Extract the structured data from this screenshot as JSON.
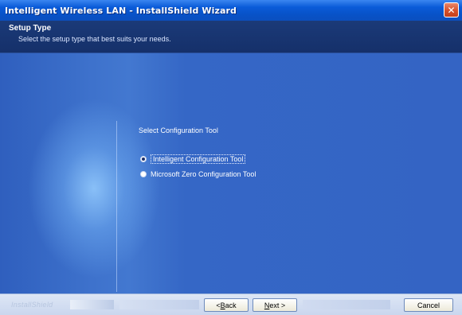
{
  "window": {
    "title": "Intelligent Wireless LAN - InstallShield Wizard",
    "close_glyph": "✕"
  },
  "header": {
    "title": "Setup Type",
    "subtitle": "Select the setup type that best suits your needs."
  },
  "main": {
    "group_label": "Select Configuration Tool",
    "options": [
      {
        "label": "Intelligent Configuration Tool",
        "selected": true
      },
      {
        "label": "Microsoft Zero Configuration Tool",
        "selected": false
      }
    ]
  },
  "footer": {
    "brand": "InstallShield",
    "back_mnemonic": "B",
    "back_rest": "ack",
    "back_prefix": "< ",
    "next_mnemonic": "N",
    "next_rest": "ext >",
    "cancel_label": "Cancel"
  },
  "colors": {
    "titlebar": "#0a5bd8",
    "header": "#15306a",
    "body": "#3464c4",
    "close": "#d5502a"
  }
}
